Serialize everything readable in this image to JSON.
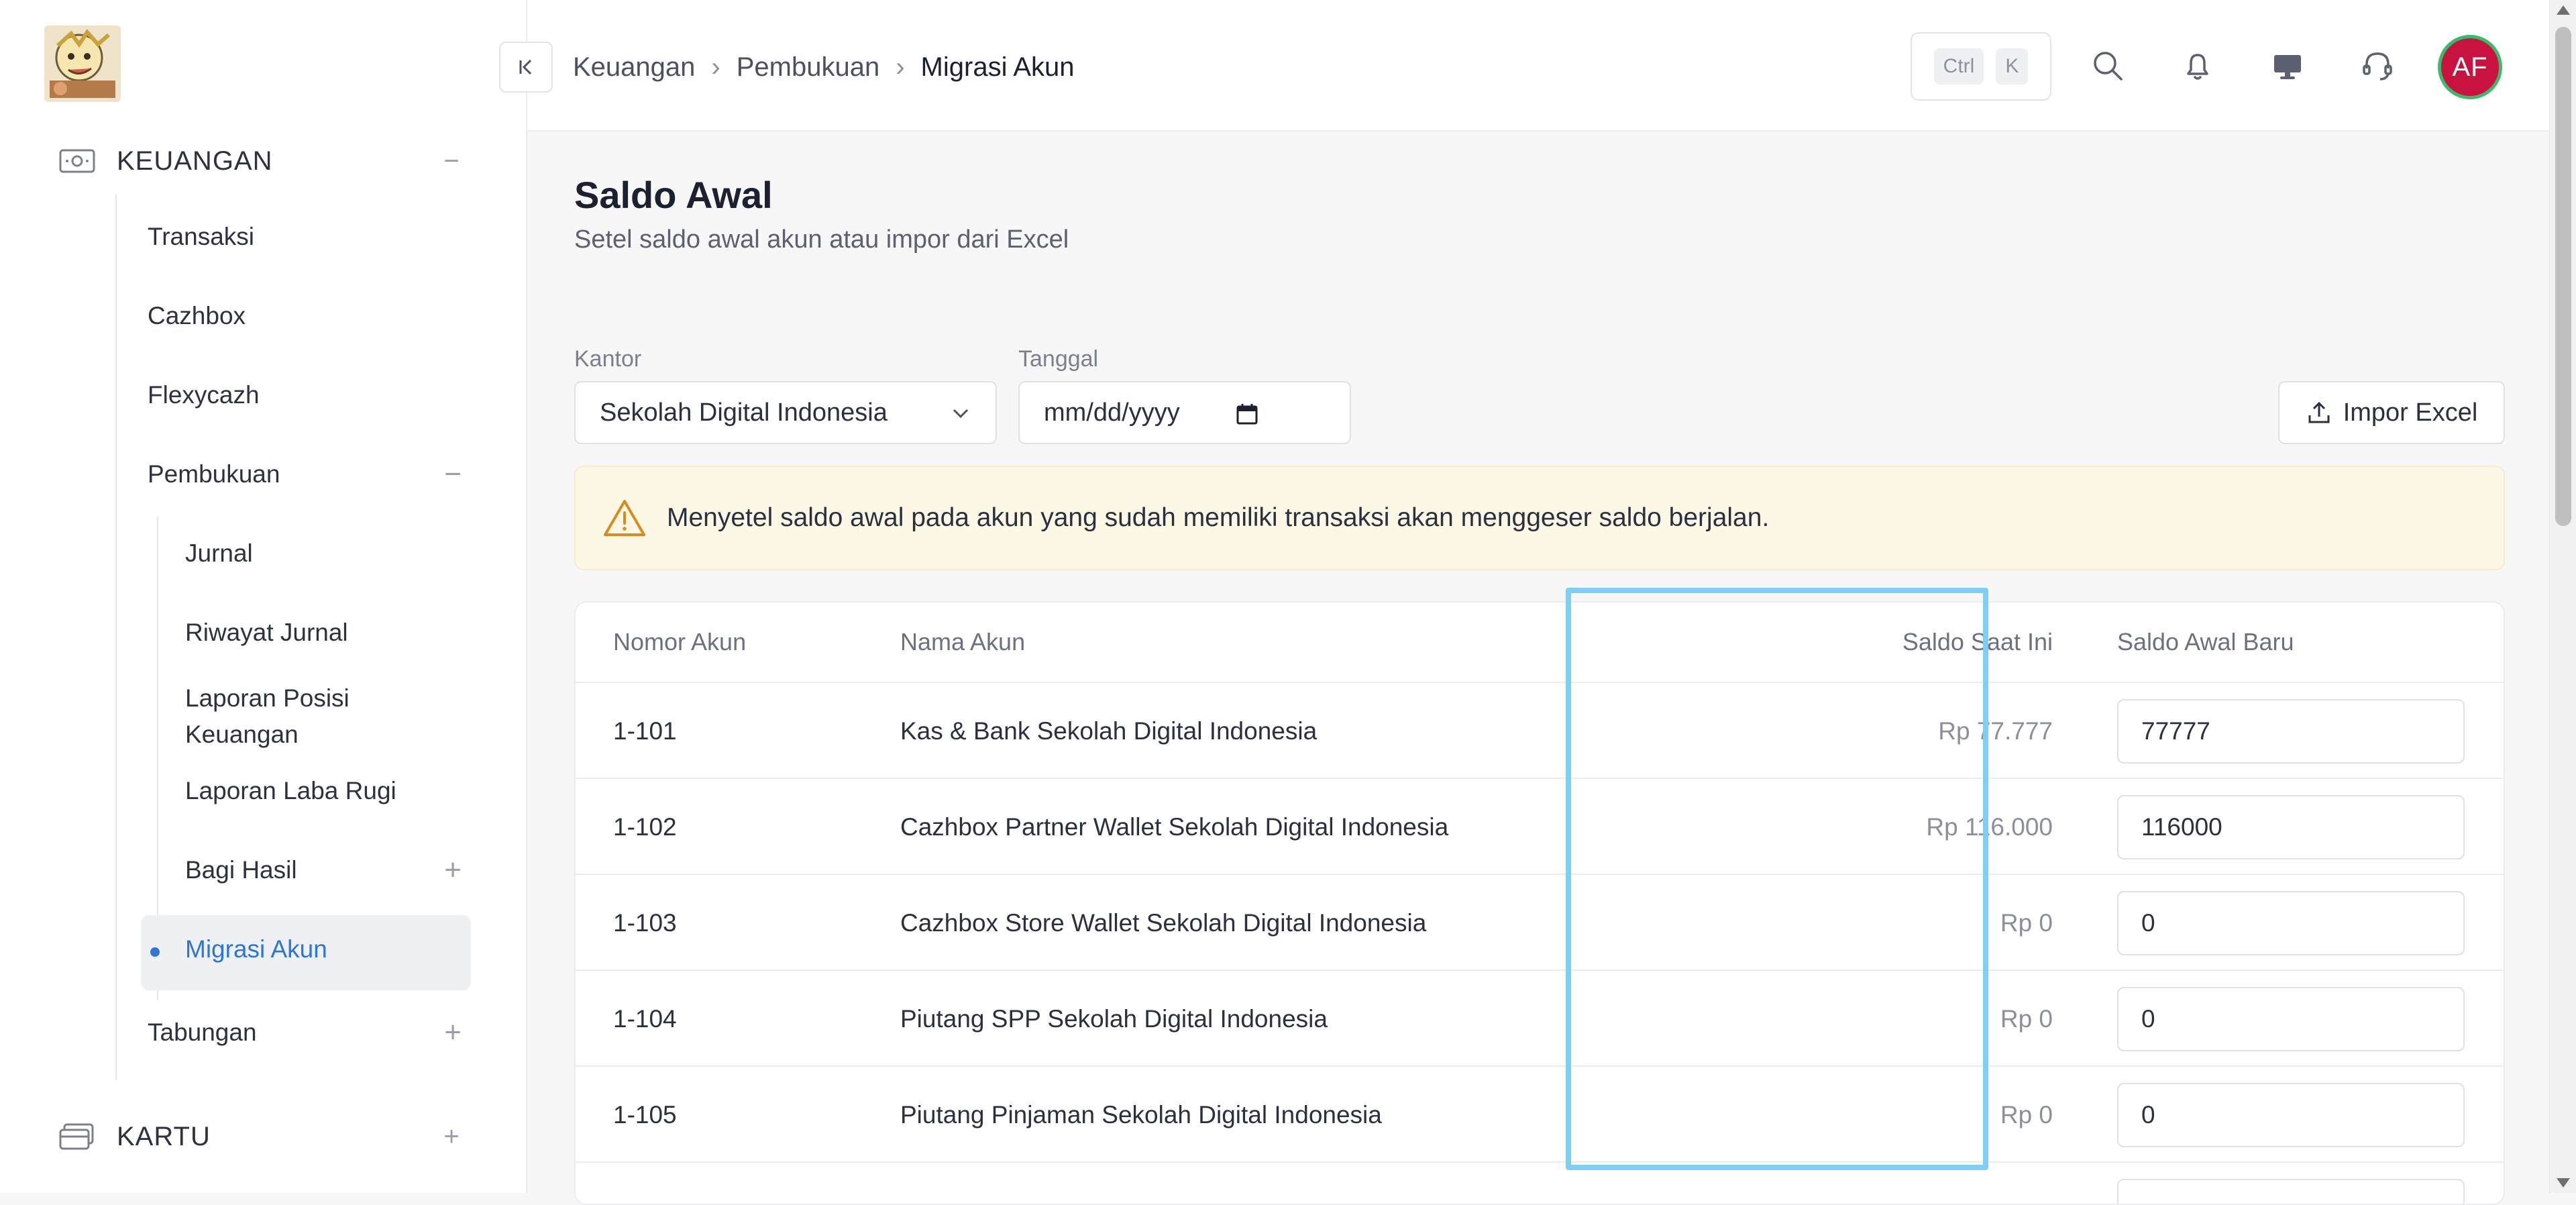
{
  "sidebar": {
    "groups": [
      {
        "label": "KEUANGAN",
        "icon": "cash-icon",
        "state": "expanded"
      },
      {
        "label": "KARTU",
        "icon": "card-icon",
        "state": "collapsed"
      }
    ],
    "keuangan_items": [
      {
        "label": "Transaksi"
      },
      {
        "label": "Cazhbox"
      },
      {
        "label": "Flexycazh"
      },
      {
        "label": "Pembukuan"
      },
      {
        "label": "Tabungan"
      }
    ],
    "pembukuan_items": [
      {
        "label": "Jurnal"
      },
      {
        "label": "Riwayat Jurnal"
      },
      {
        "label": "Laporan Posisi Keuangan"
      },
      {
        "label": "Laporan Laba Rugi"
      },
      {
        "label": "Bagi Hasil"
      },
      {
        "label": "Migrasi Akun",
        "active": true
      }
    ]
  },
  "topbar": {
    "breadcrumb": [
      "Keuangan",
      "Pembukuan",
      "Migrasi Akun"
    ],
    "shortcut": [
      "Ctrl",
      "K"
    ],
    "avatar_initials": "AF",
    "icons": [
      "search-icon",
      "bell-icon",
      "monitor-icon",
      "headset-icon"
    ]
  },
  "page": {
    "title": "Saldo Awal",
    "subtitle": "Setel saldo awal akun atau impor dari Excel"
  },
  "filters": {
    "office_label": "Kantor",
    "office_value": "Sekolah Digital Indonesia",
    "date_label": "Tanggal",
    "date_placeholder": "mm/dd/yyyy",
    "import_label": "Impor Excel"
  },
  "alert": {
    "text": "Menyetel saldo awal pada akun yang sudah memiliki transaksi akan menggeser saldo berjalan."
  },
  "table": {
    "columns": [
      "Nomor Akun",
      "Nama Akun",
      "Saldo Saat Ini",
      "Saldo Awal Baru"
    ],
    "rows": [
      {
        "number": "1-101",
        "name": "Kas & Bank Sekolah Digital Indonesia",
        "balance": "Rp 77.777",
        "new_balance": "77777"
      },
      {
        "number": "1-102",
        "name": "Cazhbox Partner Wallet Sekolah Digital Indonesia",
        "balance": "Rp 116.000",
        "new_balance": "116000"
      },
      {
        "number": "1-103",
        "name": "Cazhbox Store Wallet Sekolah Digital Indonesia",
        "balance": "Rp 0",
        "new_balance": "0"
      },
      {
        "number": "1-104",
        "name": "Piutang SPP Sekolah Digital Indonesia",
        "balance": "Rp 0",
        "new_balance": "0"
      },
      {
        "number": "1-105",
        "name": "Piutang Pinjaman Sekolah Digital Indonesia",
        "balance": "Rp 0",
        "new_balance": "0"
      }
    ]
  },
  "colors": {
    "accent": "#2c76d8",
    "avatar_bg": "#c8123f",
    "avatar_ring": "#3db96a",
    "alert_bg": "#fdf8e6",
    "highlight": "#7fcff5"
  }
}
